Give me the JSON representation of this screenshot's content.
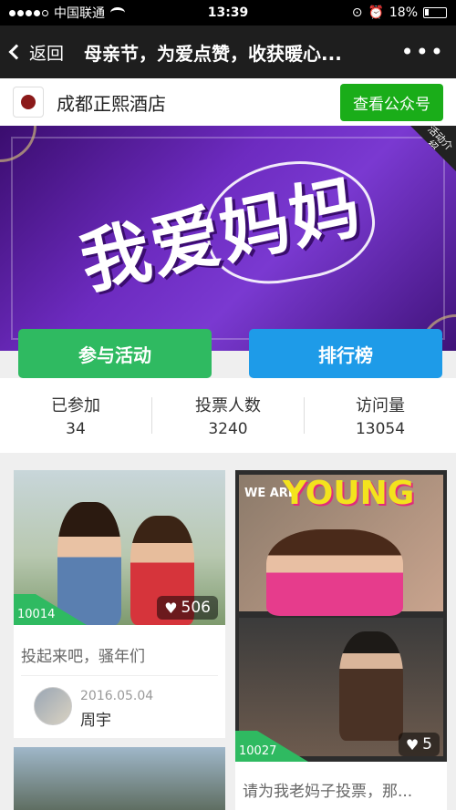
{
  "status_bar": {
    "carrier": "中国联通",
    "time": "13:39",
    "battery": "18%"
  },
  "nav": {
    "back_label": "返回",
    "title": "母亲节，为爱点赞，收获暖心...",
    "more_label": "•••"
  },
  "account": {
    "name": "成都正熙酒店",
    "button": "查看公众号"
  },
  "banner": {
    "text": "我爱妈妈",
    "tag": "活动介绍"
  },
  "actions": {
    "join": "参与活动",
    "rank": "排行榜"
  },
  "stats": [
    {
      "label": "已参加",
      "value": "34"
    },
    {
      "label": "投票人数",
      "value": "3240"
    },
    {
      "label": "访问量",
      "value": "13054"
    }
  ],
  "cards": [
    {
      "id": "10014",
      "votes": "506",
      "caption": "投起来吧，骚年们",
      "date": "2016.05.04",
      "user": "周宇"
    },
    {
      "id": "10027",
      "votes": "5",
      "caption": "请为我老妈子投票，那...",
      "we_are": "WE ARE",
      "young": "YOUNG"
    }
  ],
  "colors": {
    "green": "#2fba61",
    "blue": "#1e9be8",
    "wechat_green": "#1aad19"
  }
}
